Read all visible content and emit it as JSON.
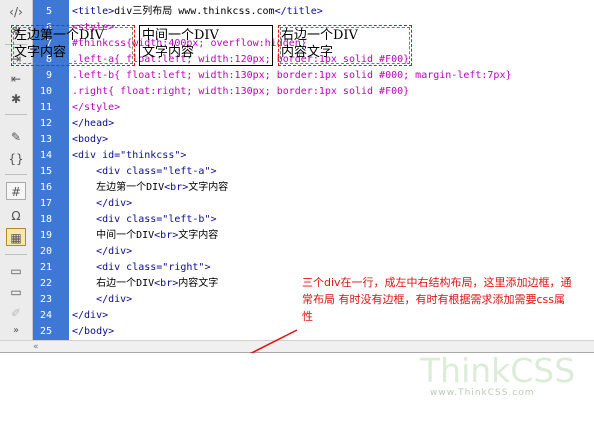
{
  "editor": {
    "line_numbers": [
      "5",
      "6",
      "7",
      "8",
      "9",
      "10",
      "11",
      "12",
      "13",
      "14",
      "15",
      "16",
      "17",
      "18",
      "19",
      "20",
      "21",
      "22",
      "23",
      "24",
      "25"
    ],
    "lines": [
      {
        "parts": [
          {
            "t": "<title>",
            "c": "tag"
          },
          {
            "t": "div三列布局 www.thinkcss.com",
            "c": "txt"
          },
          {
            "t": "</title>",
            "c": "tag"
          }
        ]
      },
      {
        "parts": [
          {
            "t": "<style>",
            "c": "sel"
          }
        ]
      },
      {
        "parts": [
          {
            "t": "#thinkcss{width:400px; overflow:hidden}",
            "c": "sel"
          }
        ]
      },
      {
        "parts": [
          {
            "t": ".left-a{ float:left; width:120px; border:1px solid #F00}",
            "c": "sel"
          }
        ]
      },
      {
        "parts": [
          {
            "t": ".left-b{ float:left; width:130px; border:1px solid #000; margin-left:7px}",
            "c": "sel"
          }
        ]
      },
      {
        "parts": [
          {
            "t": ".right{ float:right; width:130px; border:1px solid #F00}",
            "c": "sel"
          }
        ]
      },
      {
        "parts": [
          {
            "t": "</style>",
            "c": "sel"
          }
        ]
      },
      {
        "parts": [
          {
            "t": "</head>",
            "c": "tag"
          }
        ]
      },
      {
        "parts": [
          {
            "t": "<body>",
            "c": "tag"
          }
        ]
      },
      {
        "parts": [
          {
            "t": "<div id=\"thinkcss\">",
            "c": "tag"
          }
        ]
      },
      {
        "parts": [
          {
            "t": "    <div class=\"left-a\">",
            "c": "tag"
          }
        ]
      },
      {
        "parts": [
          {
            "t": "    左边第一个DIV",
            "c": "txt"
          },
          {
            "t": "<br>",
            "c": "tag"
          },
          {
            "t": "文字内容",
            "c": "txt"
          }
        ]
      },
      {
        "parts": [
          {
            "t": "    </div>",
            "c": "tag"
          }
        ]
      },
      {
        "parts": [
          {
            "t": "    <div class=\"left-b\">",
            "c": "tag"
          }
        ]
      },
      {
        "parts": [
          {
            "t": "    中间一个DIV",
            "c": "txt"
          },
          {
            "t": "<br>",
            "c": "tag"
          },
          {
            "t": "文字内容",
            "c": "txt"
          }
        ]
      },
      {
        "parts": [
          {
            "t": "    </div>",
            "c": "tag"
          }
        ]
      },
      {
        "parts": [
          {
            "t": "    <div class=\"right\">",
            "c": "tag"
          }
        ]
      },
      {
        "parts": [
          {
            "t": "    右边一个DIV",
            "c": "txt"
          },
          {
            "t": "<br>",
            "c": "tag"
          },
          {
            "t": "内容文字",
            "c": "txt"
          }
        ]
      },
      {
        "parts": [
          {
            "t": "    </div>",
            "c": "tag"
          }
        ]
      },
      {
        "parts": [
          {
            "t": "</div>",
            "c": "tag"
          }
        ]
      },
      {
        "parts": [
          {
            "t": "</body>",
            "c": "tag"
          }
        ]
      }
    ]
  },
  "toolbar_icons": [
    "tag-icon",
    "gear-icon",
    "indent-icon",
    "outdent-icon",
    "tree-icon",
    "collapse-icon",
    "brace-icon",
    "hash-icon",
    "omega-icon",
    "layout-icon",
    "comment-icon",
    "uncomment-icon",
    "pencil-icon",
    "chevron-double-down-icon"
  ],
  "scroll": {
    "collapse_glyph": "«"
  },
  "annotation": {
    "text": "三个div在一行，成左中右结构布局，这里添加边框，通常布局 有时没有边框，有时有根据需求添加需要css属性",
    "color": "#e01010"
  },
  "design_view": {
    "box_a": {
      "line1": "左边第一个DIV",
      "line2": "文字内容",
      "border_color": "#FF0000"
    },
    "box_b": {
      "line1": "中间一个DIV",
      "line2": "文字内容",
      "border_color": "#000000"
    },
    "box_c": {
      "line1": "右边一个DIV",
      "line2": "内容文字",
      "border_color": "#FF0000"
    }
  },
  "watermark": {
    "logo": "ThinkCSS",
    "url": "www.ThinkCSS.com"
  },
  "colors": {
    "gutter": "#3f78d4",
    "tag": "#0a0a9a",
    "selector": "#c000c0"
  }
}
